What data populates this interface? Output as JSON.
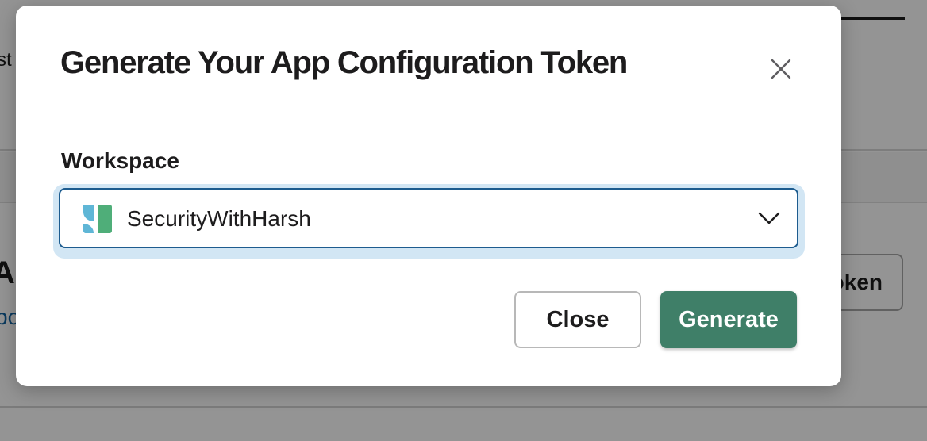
{
  "modal": {
    "title": "Generate Your App Configuration Token",
    "close_icon": "close-icon"
  },
  "workspace_field": {
    "label": "Workspace",
    "selected_value": "SecurityWithHarsh",
    "logo_icon": "workspace-logo-icon",
    "dropdown_icon": "chevron-down-icon"
  },
  "actions": {
    "close_label": "Close",
    "generate_label": "Generate"
  },
  "background": {
    "header_fragment": "st",
    "title_fragment": "Ap",
    "link_fragment": "bo",
    "button_fragment": "oken"
  },
  "colors": {
    "primary_button": "#3f7f68",
    "select_border": "#1d5c8f",
    "focus_ring": "#d2e6f4",
    "logo_blue": "#5fb6d6",
    "logo_green": "#4fae79"
  }
}
